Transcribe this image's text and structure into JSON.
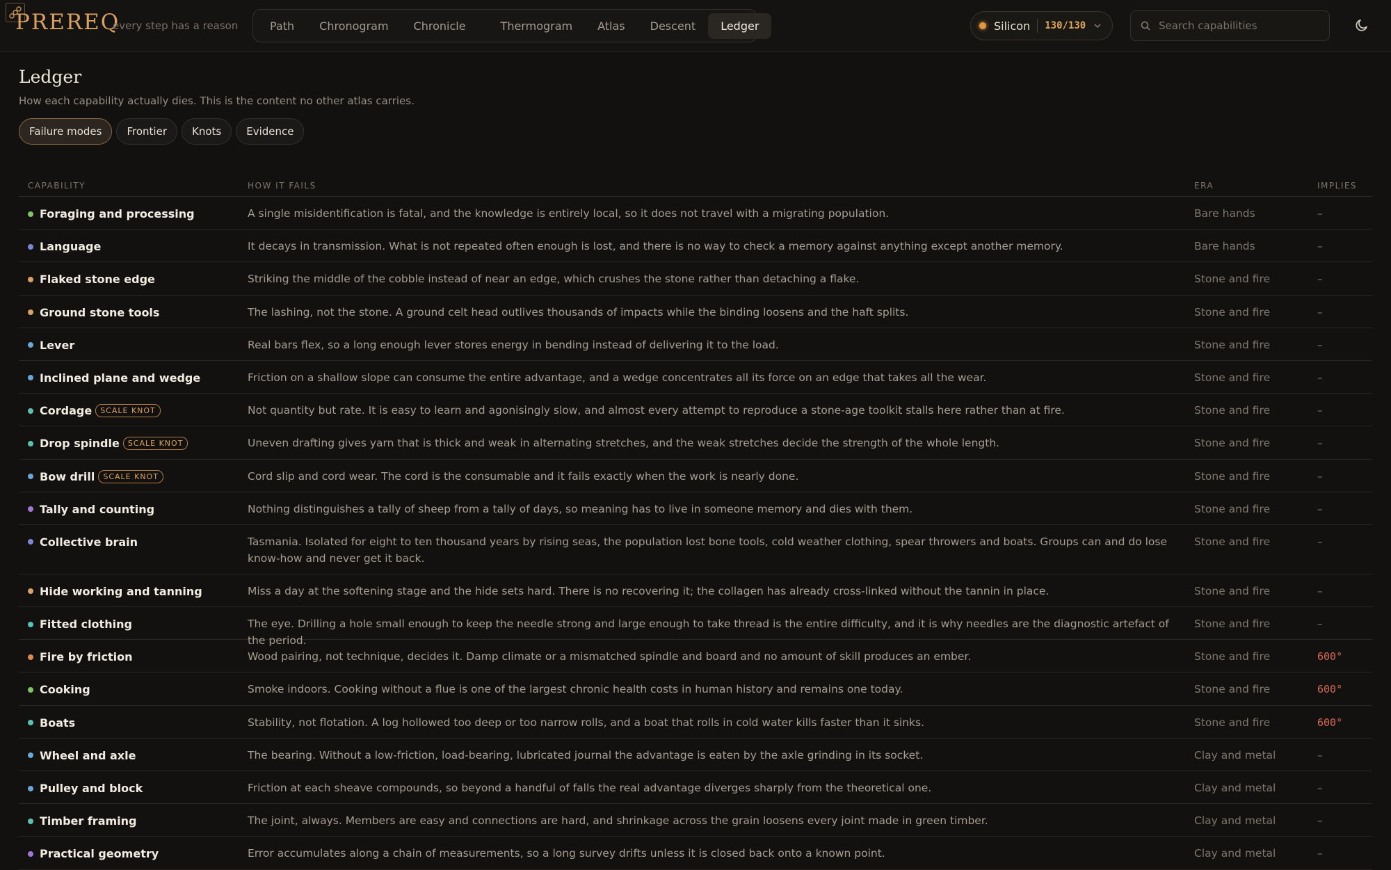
{
  "app": {
    "logo": "PREREQ",
    "tagline": "every step has a reason"
  },
  "nav": [
    {
      "label": "Path",
      "active": false
    },
    {
      "label": "Chronogram",
      "active": false
    },
    {
      "label": "Chronicle",
      "active": false
    },
    {
      "label": "Thermogram",
      "active": false
    },
    {
      "label": "Atlas",
      "active": false
    },
    {
      "label": "Descent",
      "active": false
    },
    {
      "label": "Ledger",
      "active": true
    }
  ],
  "material": {
    "label": "Silicon",
    "count": "130/130"
  },
  "search": {
    "placeholder": "Search capabilities"
  },
  "page": {
    "title": "Ledger",
    "subtitle": "How each capability actually dies. This is the content no other atlas carries."
  },
  "tabs": [
    {
      "label": "Failure modes",
      "active": true
    },
    {
      "label": "Frontier",
      "active": false
    },
    {
      "label": "Knots",
      "active": false
    },
    {
      "label": "Evidence",
      "active": false
    }
  ],
  "table": {
    "headers": {
      "capability": "CAPABILITY",
      "fails": "HOW IT FAILS",
      "era": "ERA",
      "implies": "IMPLIES"
    },
    "rows": [
      {
        "name": "Foraging and processing",
        "color": "#7ec46a",
        "knot": "",
        "fails": "A single misidentification is fatal, and the knowledge is entirely local, so it does not travel with a migrating population.",
        "era": "Bare hands",
        "implies": "–"
      },
      {
        "name": "Language",
        "color": "#7d87d6",
        "knot": "",
        "fails": "It decays in transmission. What is not repeated often enough is lost, and there is no way to check a memory against anything except another memory.",
        "era": "Bare hands",
        "implies": "–"
      },
      {
        "name": "Flaked stone edge",
        "color": "#d9a46a",
        "knot": "",
        "fails": "Striking the middle of the cobble instead of near an edge, which crushes the stone rather than detaching a flake.",
        "era": "Stone and fire",
        "implies": "–"
      },
      {
        "name": "Ground stone tools",
        "color": "#d9a46a",
        "knot": "",
        "fails": "The lashing, not the stone. A ground celt head outlives thousands of impacts while the binding loosens and the haft splits.",
        "era": "Stone and fire",
        "implies": "–"
      },
      {
        "name": "Lever",
        "color": "#6aa6d6",
        "knot": "",
        "fails": "Real bars flex, so a long enough lever stores energy in bending instead of delivering it to the load.",
        "era": "Stone and fire",
        "implies": "–"
      },
      {
        "name": "Inclined plane and wedge",
        "color": "#6aa6d6",
        "knot": "",
        "fails": "Friction on a shallow slope can consume the entire advantage, and a wedge concentrates all its force on an edge that takes all the wear.",
        "era": "Stone and fire",
        "implies": "–"
      },
      {
        "name": "Cordage",
        "color": "#5cc2b0",
        "knot": "SCALE KNOT",
        "fails": "Not quantity but rate. It is easy to learn and agonisingly slow, and almost every attempt to reproduce a stone-age toolkit stalls here rather than at fire.",
        "era": "Stone and fire",
        "implies": "–"
      },
      {
        "name": "Drop spindle",
        "color": "#5cc2b0",
        "knot": "SCALE KNOT",
        "fails": "Uneven drafting gives yarn that is thick and weak in alternating stretches, and the weak stretches decide the strength of the whole length.",
        "era": "Stone and fire",
        "implies": "–"
      },
      {
        "name": "Bow drill",
        "color": "#6aa6d6",
        "knot": "SCALE KNOT",
        "fails": "Cord slip and cord wear. The cord is the consumable and it fails exactly when the work is nearly done.",
        "era": "Stone and fire",
        "implies": "–"
      },
      {
        "name": "Tally and counting",
        "color": "#a078d8",
        "knot": "",
        "fails": "Nothing distinguishes a tally of sheep from a tally of days, so meaning has to live in someone memory and dies with them.",
        "era": "Stone and fire",
        "implies": "–"
      },
      {
        "name": "Collective brain",
        "color": "#7d87d6",
        "knot": "",
        "fails": "Tasmania. Isolated for eight to ten thousand years by rising seas, the population lost bone tools, cold weather clothing, spear throwers and boats. Groups can and do lose know-how and never get it back.",
        "era": "Stone and fire",
        "implies": "–",
        "tall": true
      },
      {
        "name": "Hide working and tanning",
        "color": "#d9a46a",
        "knot": "",
        "fails": "Miss a day at the softening stage and the hide sets hard. There is no recovering it; the collagen has already cross-linked without the tannin in place.",
        "era": "Stone and fire",
        "implies": "–"
      },
      {
        "name": "Fitted clothing",
        "color": "#5cc2b0",
        "knot": "",
        "fails": "The eye. Drilling a hole small enough to keep the needle strong and large enough to take thread is the entire difficulty, and it is why needles are the diagnostic artefact of the period.",
        "era": "Stone and fire",
        "implies": "–"
      },
      {
        "name": "Fire by friction",
        "color": "#e08a4e",
        "knot": "",
        "fails": "Wood pairing, not technique, decides it. Damp climate or a mismatched spindle and board and no amount of skill produces an ember.",
        "era": "Stone and fire",
        "implies": "600°"
      },
      {
        "name": "Cooking",
        "color": "#7ec46a",
        "knot": "",
        "fails": "Smoke indoors. Cooking without a flue is one of the largest chronic health costs in human history and remains one today.",
        "era": "Stone and fire",
        "implies": "600°"
      },
      {
        "name": "Boats",
        "color": "#5cc2b0",
        "knot": "",
        "fails": "Stability, not flotation. A log hollowed too deep or too narrow rolls, and a boat that rolls in cold water kills faster than it sinks.",
        "era": "Stone and fire",
        "implies": "600°"
      },
      {
        "name": "Wheel and axle",
        "color": "#6aa6d6",
        "knot": "",
        "fails": "The bearing. Without a low-friction, load-bearing, lubricated journal the advantage is eaten by the axle grinding in its socket.",
        "era": "Clay and metal",
        "implies": "–"
      },
      {
        "name": "Pulley and block",
        "color": "#6aa6d6",
        "knot": "",
        "fails": "Friction at each sheave compounds, so beyond a handful of falls the real advantage diverges sharply from the theoretical one.",
        "era": "Clay and metal",
        "implies": "–"
      },
      {
        "name": "Timber framing",
        "color": "#5cc2b0",
        "knot": "",
        "fails": "The joint, always. Members are easy and connections are hard, and shrinkage across the grain loosens every joint made in green timber.",
        "era": "Clay and metal",
        "implies": "–"
      },
      {
        "name": "Practical geometry",
        "color": "#a078d8",
        "knot": "",
        "fails": "Error accumulates along a chain of measurements, so a long survey drifts unless it is closed back onto a known point.",
        "era": "Clay and metal",
        "implies": "–"
      }
    ]
  }
}
